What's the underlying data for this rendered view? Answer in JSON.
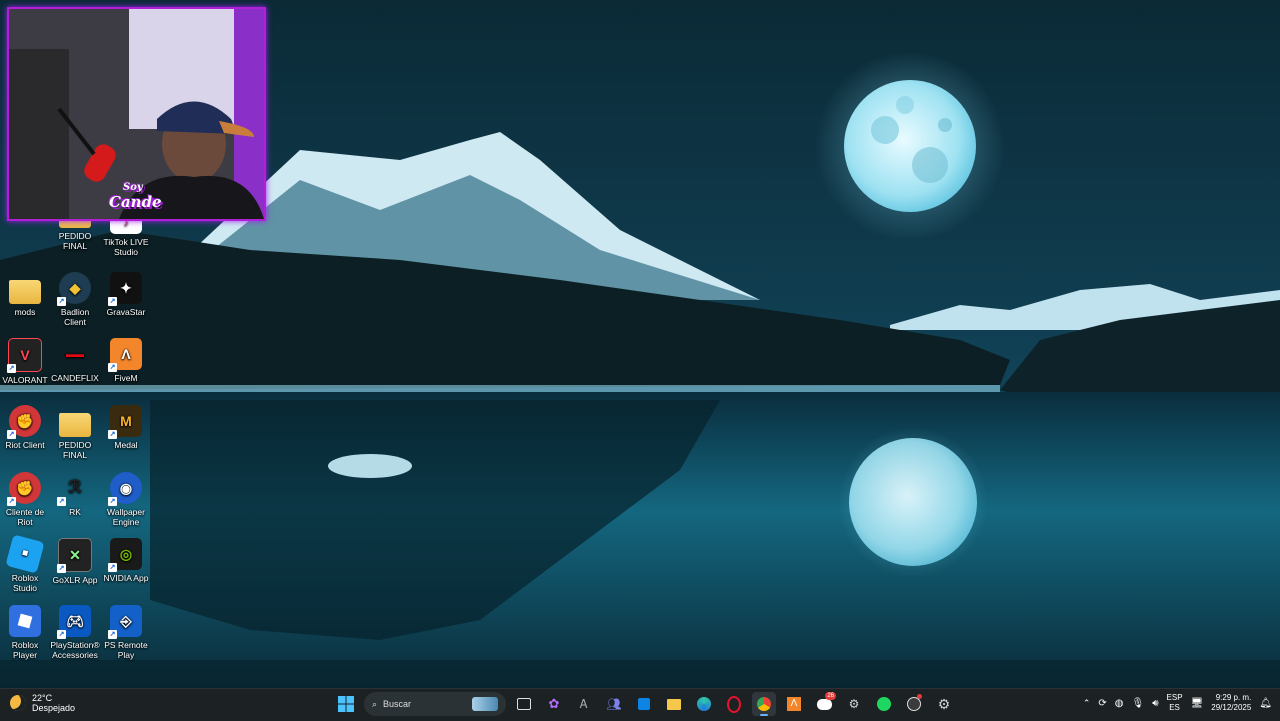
{
  "desktop": {
    "icons": [
      {
        "label": "PEDIDO FINAL",
        "icon": "folder-icon"
      },
      {
        "label": "TikTok LIVE Studio",
        "icon": "tiktok-icon"
      },
      {
        "label": "mods",
        "icon": "folder-icon"
      },
      {
        "label": "Badlion Client",
        "icon": "badlion-icon"
      },
      {
        "label": "GravaStar",
        "icon": "gravastar-icon"
      },
      {
        "label": "VALORANT",
        "icon": "valorant-icon"
      },
      {
        "label": "CANDEFLIX",
        "icon": "candeflix-icon"
      },
      {
        "label": "FiveM",
        "icon": "fivem-icon"
      },
      {
        "label": "Riot Client",
        "icon": "riot-icon"
      },
      {
        "label": "PEDIDO FINAL",
        "icon": "folder-icon"
      },
      {
        "label": "Medal",
        "icon": "medal-icon"
      },
      {
        "label": "Cliente de Riot",
        "icon": "riot-icon"
      },
      {
        "label": "RK",
        "icon": "rk-icon"
      },
      {
        "label": "Wallpaper Engine",
        "icon": "wallpaper-engine-icon"
      },
      {
        "label": "Roblox Studio",
        "icon": "roblox-studio-icon"
      },
      {
        "label": "GoXLR App",
        "icon": "goxlr-icon"
      },
      {
        "label": "NVIDIA App",
        "icon": "nvidia-icon"
      },
      {
        "label": "Roblox Player",
        "icon": "roblox-icon"
      },
      {
        "label": "PlayStation® Accessories",
        "icon": "playstation-icon"
      },
      {
        "label": "PS Remote Play",
        "icon": "ps-remote-icon"
      }
    ]
  },
  "webcam": {
    "logo_line1": "Soy",
    "logo_line2": "Cande"
  },
  "taskbar": {
    "weather_temp": "22°C",
    "weather_desc": "Despejado",
    "search_placeholder": "Buscar",
    "lang_line1": "ESP",
    "lang_line2": "ES",
    "time": "9:29 p. m.",
    "date": "29/12/2025",
    "discord_badge": "26"
  },
  "colors": {
    "accent": "#6ab1ff",
    "webcam_border": "#b31ed8",
    "taskbar_bg": "#1c2124"
  }
}
